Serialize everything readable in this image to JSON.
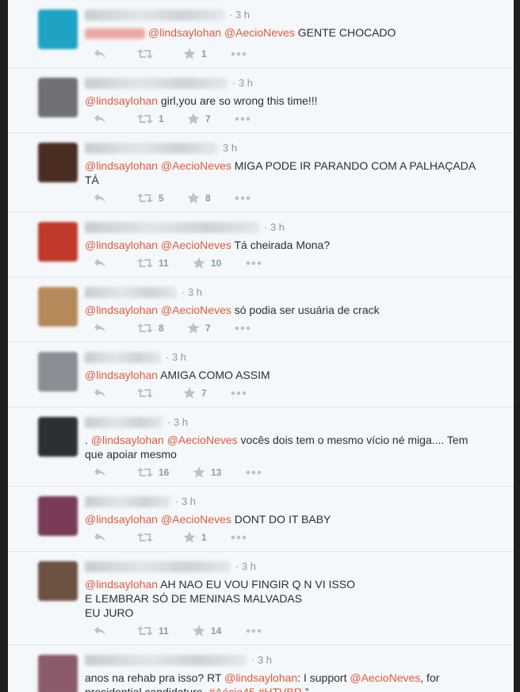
{
  "timeline": {
    "tweets": [
      {
        "time": "· 3 h",
        "text_before": "",
        "mentions": [
          "@lindsaylohan",
          "@AecioNeves"
        ],
        "text_after": " GENTE CHOCADO",
        "retweets": "",
        "favorites": "1",
        "avatar_color": "#1fa3c4"
      },
      {
        "time": "· 3 h",
        "text_before": "",
        "mentions": [
          "@lindsaylohan"
        ],
        "text_after": " girl,you are so wrong this time!!!",
        "retweets": "1",
        "favorites": "7",
        "avatar_color": "#6e7074"
      },
      {
        "time": "3 h",
        "text_before": "",
        "mentions": [
          "@lindsaylohan",
          "@AecioNeves"
        ],
        "text_after": " MIGA PODE IR PARANDO COM A PALHAÇADA TÁ",
        "retweets": "5",
        "favorites": "8",
        "avatar_color": "#4a2c22"
      },
      {
        "time": "· 3 h",
        "text_before": "",
        "mentions": [
          "@lindsaylohan",
          "@AecioNeves"
        ],
        "text_after": " Tá cheirada Mona?",
        "retweets": "11",
        "favorites": "10",
        "avatar_color": "#c0392b"
      },
      {
        "time": "· 3 h",
        "text_before": "",
        "mentions": [
          "@lindsaylohan",
          "@AecioNeves"
        ],
        "text_after": " só podia ser usuária de crack",
        "retweets": "8",
        "favorites": "7",
        "avatar_color": "#b5895a"
      },
      {
        "time": "· 3 h",
        "text_before": "",
        "mentions": [
          "@lindsaylohan"
        ],
        "text_after": " AMIGA COMO ASSIM",
        "retweets": "",
        "favorites": "7",
        "avatar_color": "#8a8f96"
      },
      {
        "time": "· 3 h",
        "text_before": ". ",
        "mentions": [
          "@lindsaylohan",
          "@AecioNeves"
        ],
        "text_after": " vocês dois tem o mesmo vício né miga.... Tem que apoiar mesmo",
        "retweets": "16",
        "favorites": "13",
        "avatar_color": "#2c2f33"
      },
      {
        "time": "· 3 h",
        "text_before": "",
        "mentions": [
          "@lindsaylohan",
          "@AecioNeves"
        ],
        "text_after": " DONT DO IT BABY",
        "retweets": "",
        "favorites": "1",
        "avatar_color": "#7a3b5a"
      },
      {
        "time": "· 3 h",
        "text_before": "",
        "mentions": [
          "@lindsaylohan"
        ],
        "text_after": " AH NAO EU VOU FINGIR Q N VI ISSO\nE LEMBRAR SÓ DE MENINAS MALVADAS\nEU JURO",
        "retweets": "11",
        "favorites": "14",
        "avatar_color": "#6b5242"
      },
      {
        "time": "· 3 h",
        "text_before": "anos na rehab pra isso? RT ",
        "mentions": [
          "@lindsaylohan",
          "@AecioNeves"
        ],
        "mention_joiners": [
          ": I support ",
          ", for\npresidential candidature. "
        ],
        "hashtags": [
          "#Aécio45",
          "#HTVBR"
        ],
        "text_after": " ”",
        "retweets": "",
        "favorites": "",
        "avatar_color": "#8b5a6b"
      }
    ]
  },
  "icons": {
    "reply": "reply-icon",
    "retweet": "retweet-icon",
    "favorite": "star-icon",
    "more": "more-icon"
  }
}
